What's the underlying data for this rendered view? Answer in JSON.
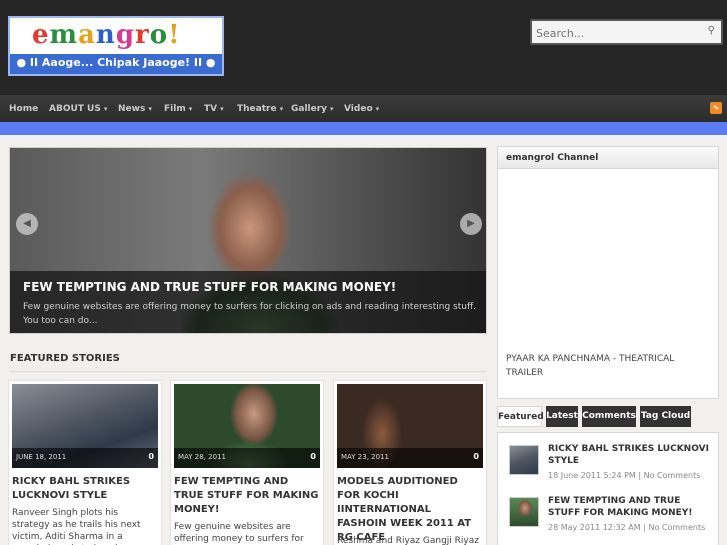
{
  "site": {
    "logo_letters": [
      "e",
      "m",
      "a",
      "n",
      "g",
      "r",
      "o",
      "!"
    ],
    "tagline": "● II Aaoge... Chipak Jaaoge! II ●"
  },
  "search": {
    "placeholder": "Search...",
    "value": "Search..."
  },
  "nav": {
    "items": [
      {
        "label": "Home",
        "dropdown": false
      },
      {
        "label": "ABOUT US",
        "dropdown": true
      },
      {
        "label": "News",
        "dropdown": true
      },
      {
        "label": "Film",
        "dropdown": true
      },
      {
        "label": "TV",
        "dropdown": true
      },
      {
        "label": "Theatre",
        "dropdown": true
      },
      {
        "label": "Gallery",
        "dropdown": true
      },
      {
        "label": "Video",
        "dropdown": true
      }
    ],
    "caret": "▾",
    "rss_icon": "rss-icon"
  },
  "slider": {
    "title": "FEW TEMPTING AND TRUE STUFF FOR MAKING MONEY!",
    "text": "Few genuine websites are offering money to surfers for clicking on ads and reading interesting stuff. You too can do...",
    "prev": "◀",
    "next": "▶"
  },
  "featured": {
    "heading": "FEATURED STORIES",
    "cards": [
      {
        "date": "JUNE 18, 2011",
        "comments": "0",
        "title": "RICKY BAHL STRIKES LUCKNOVI STYLE",
        "text": "Ranveer Singh plots his strategy as he trails his next victim, Aditi Sharma in a crowded market place in Lucknow. Shooting..."
      },
      {
        "date": "MAY 28, 2011",
        "comments": "0",
        "title": "FEW TEMPTING AND TRUE STUFF FOR MAKING MONEY!",
        "text": "Few genuine websites are offering money to surfers for clicking on ads and reading interesting..."
      },
      {
        "date": "MAY 23, 2011",
        "comments": "0",
        "title": "MODELS AUDITIONED FOR KOCHI IINTERNATIONAL FASHOIN WEEK 2011 AT RG CAFE",
        "text": "Reshma and Riyaz Gangji Riyaz"
      }
    ]
  },
  "sidebar": {
    "channel_title": "emangrol Channel",
    "video_title": "PYAAR KA PANCHNAMA - THEATRICAL TRAILER",
    "tabs": [
      "Featured",
      "Latest",
      "Comments",
      "Tag Cloud"
    ],
    "items": [
      {
        "title": "RICKY BAHL STRIKES LUCKNOVI STYLE",
        "meta": "18 June 2011 5:24 PM | No Comments"
      },
      {
        "title": "FEW TEMPTING AND TRUE STUFF FOR MAKING MONEY!",
        "meta": "28 May 2011 12:32 AM | No Comments"
      }
    ]
  }
}
